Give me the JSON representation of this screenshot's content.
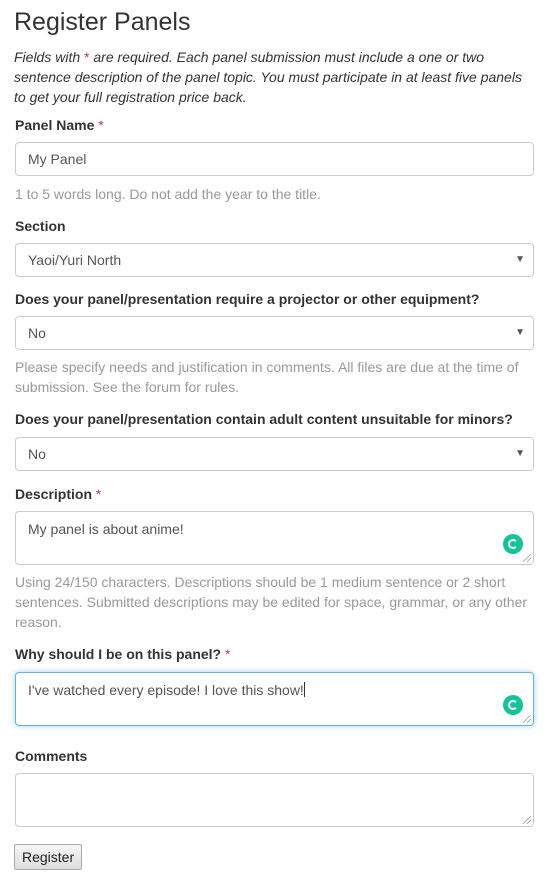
{
  "page": {
    "title": "Register Panels"
  },
  "intro": {
    "before_star": "Fields with ",
    "star": "*",
    "after_star": " are required. Each panel submission must include a one or two sentence description of the panel topic. You must participate in at least five panels to get your full registration price back."
  },
  "required_marker": "*",
  "panel_name": {
    "label": "Panel Name",
    "value": "My Panel",
    "help": "1 to 5 words long. Do not add the year to the title."
  },
  "section": {
    "label": "Section",
    "selected": "Yaoi/Yuri North"
  },
  "equipment": {
    "label": "Does your panel/presentation require a projector or other equipment?",
    "selected": "No",
    "help": "Please specify needs and justification in comments. All files are due at the time of submission. See the forum for rules."
  },
  "adult_content": {
    "label": "Does your panel/presentation contain adult content unsuitable for minors?",
    "selected": "No"
  },
  "description": {
    "label": "Description",
    "value": "My panel is about anime!",
    "help": "Using 24/150 characters. Descriptions should be 1 medium sentence or 2 short sentences. Submitted descriptions may be edited for space, grammar, or any other reason."
  },
  "why": {
    "label": "Why should I be on this panel?",
    "value": "I've watched every episode! I love this show!"
  },
  "comments": {
    "label": "Comments",
    "value": ""
  },
  "register_button": {
    "label": "Register"
  },
  "icons": {
    "select_caret": "▼",
    "grammarly": "grammarly-icon"
  },
  "colors": {
    "required": "#a94442",
    "focus_border": "#66afe9",
    "grammarly": "#15c39a",
    "help_text": "#999999"
  }
}
